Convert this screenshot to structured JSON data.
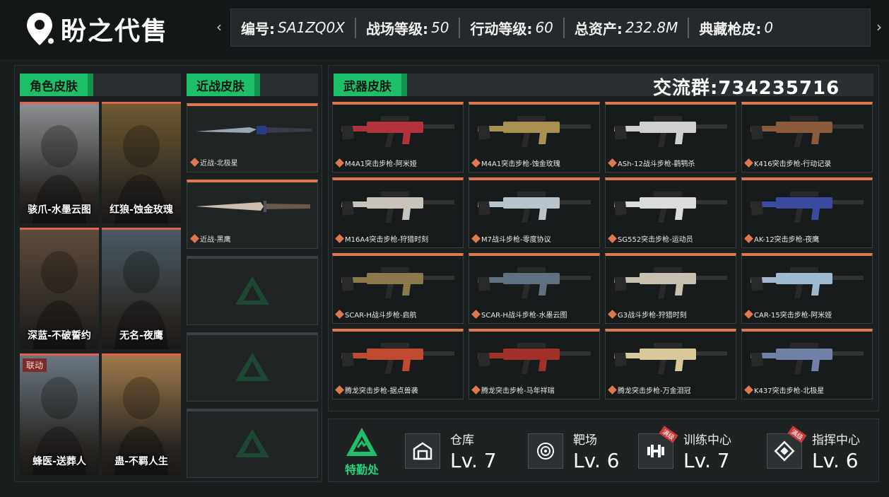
{
  "header": {
    "logo_text": "盼之代售",
    "stats": [
      {
        "label": "编号:",
        "value": "SA1ZQ0X"
      },
      {
        "label": "战场等级:",
        "value": "50"
      },
      {
        "label": "行动等级:",
        "value": "60"
      },
      {
        "label": "总资产:",
        "value": "232.8M"
      },
      {
        "label": "典藏枪皮:",
        "value": "0"
      }
    ]
  },
  "sections": {
    "character": "角色皮肤",
    "melee": "近战皮肤",
    "weapon": "武器皮肤"
  },
  "group": "交流群:734235716",
  "characters": [
    {
      "label": "骇爪-水墨云图",
      "color": "#8c8f92",
      "badge": ""
    },
    {
      "label": "红狼-蚀金玫瑰",
      "color": "#6f5a30",
      "badge": ""
    },
    {
      "label": "深蓝-不破誓约",
      "color": "#5d4a3a",
      "badge": ""
    },
    {
      "label": "无名-夜鹰",
      "color": "#4a5a63",
      "badge": ""
    },
    {
      "label": "蜂医-送葬人",
      "color": "#6a7680",
      "badge": "联动"
    },
    {
      "label": "蛊-不羁人生",
      "color": "#a07a4a",
      "badge": ""
    }
  ],
  "melee": [
    {
      "label": "近战-北极星"
    },
    {
      "label": "近战-黑鹰"
    }
  ],
  "weapons": [
    {
      "label": "M4A1突击步枪-阿米娅",
      "color": "#b0323a"
    },
    {
      "label": "M4A1突击步枪-蚀金玫瑰",
      "color": "#a89050"
    },
    {
      "label": "ASh-12战斗步枪-鹳鹗杀",
      "color": "#d0d0d0"
    },
    {
      "label": "K416突击步枪-行动记录",
      "color": "#8a5a3a"
    },
    {
      "label": "M16A4突击步枪-狩猎时刻",
      "color": "#c8c4bc"
    },
    {
      "label": "M7战斗步枪-零度协议",
      "color": "#b8c4cc"
    },
    {
      "label": "SG552突击步枪-运动员",
      "color": "#dcdcdc"
    },
    {
      "label": "AK-12突击步枪-夜鹰",
      "color": "#3a4aa0"
    },
    {
      "label": "SCAR-H战斗步枪-启航",
      "color": "#8a7a4a"
    },
    {
      "label": "SCAR-H战斗步枪-水墨云图",
      "color": "#607080"
    },
    {
      "label": "G3战斗步枪-狩猎时刻",
      "color": "#c8c0b0"
    },
    {
      "label": "CAR-15突击步枪-阿米娅",
      "color": "#a0b8d0"
    },
    {
      "label": "腾龙突击步枪-据点兽袭",
      "color": "#c04a30"
    },
    {
      "label": "腾龙突击步枪-马年祥瑞",
      "color": "#a03028"
    },
    {
      "label": "腾龙突击步枪-万金泪冠",
      "color": "#d8c89a"
    },
    {
      "label": "K437突击步枪-北极星",
      "color": "#7080a8"
    }
  ],
  "bottom": {
    "hq_label": "特勤处",
    "facilities": [
      {
        "name": "仓库",
        "level": "Lv. 7",
        "icon": "warehouse-icon",
        "max_badge": ""
      },
      {
        "name": "靶场",
        "level": "Lv. 6",
        "icon": "target-icon",
        "max_badge": ""
      },
      {
        "name": "训练中心",
        "level": "Lv. 7",
        "icon": "dumbbell-icon",
        "max_badge": "满级"
      },
      {
        "name": "指挥中心",
        "level": "Lv. 6",
        "icon": "command-icon",
        "max_badge": "满级"
      }
    ]
  },
  "colors": {
    "accent": "#1fbf6a",
    "card_top": "#e0784f",
    "bg": "#1a1d1e"
  }
}
